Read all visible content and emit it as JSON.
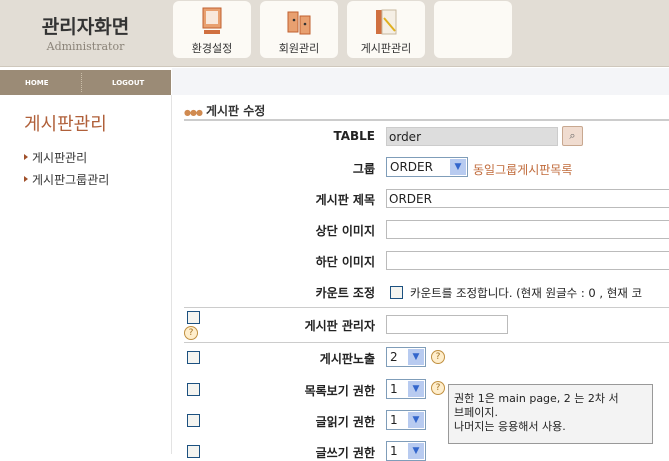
{
  "header": {
    "title": "관리자화면",
    "subtitle": "Administrator",
    "menu": [
      {
        "label": "환경설정",
        "icon": "monitor-icon"
      },
      {
        "label": "회원관리",
        "icon": "members-icon"
      },
      {
        "label": "게시판관리",
        "icon": "board-icon"
      },
      {
        "label": "",
        "icon": ""
      }
    ]
  },
  "nav": {
    "home": "HOME",
    "logout": "LOGOUT"
  },
  "sidebar": {
    "title": "게시판관리",
    "items": [
      {
        "label": "게시판관리"
      },
      {
        "label": "게시판그룹관리"
      }
    ]
  },
  "form": {
    "section_title": "게시판 수정",
    "table_label": "TABLE",
    "table_value": "order",
    "group_label": "그룹",
    "group_value": "ORDER",
    "group_link": "동일그룹게시판목록",
    "subject_label": "게시판 제목",
    "subject_value": "ORDER",
    "top_image_label": "상단 이미지",
    "top_image_value": "",
    "bottom_image_label": "하단 이미지",
    "bottom_image_value": "",
    "count_label": "카운트 조정",
    "count_text": "카운트를 조정합니다. (현재 원글수 : 0 , 현재 코",
    "admin_label": "게시판 관리자",
    "admin_value": "",
    "expose_label": "게시판노출",
    "expose_value": "2",
    "list_perm_label": "목록보기 권한",
    "list_perm_value": "1",
    "read_perm_label": "글읽기 권한",
    "read_perm_value": "1",
    "write_perm_label": "글쓰기 권한",
    "write_perm_value": "1"
  },
  "tooltip": {
    "line1": "권한 1은 main page, 2 는 2차 서",
    "line2": "브페이지.",
    "line3": "나머지는 응용해서 사용."
  }
}
